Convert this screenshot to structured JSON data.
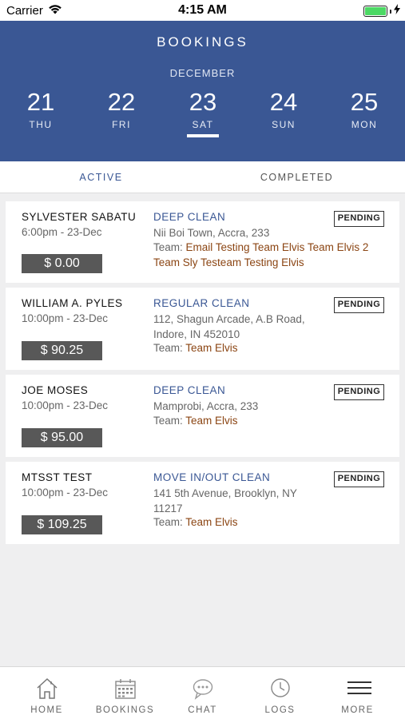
{
  "status_bar": {
    "carrier": "Carrier",
    "time": "4:15 AM",
    "battery_level": 1.0,
    "wifi_icon": "wifi-icon",
    "charging_icon": "charging-bolt-icon"
  },
  "header": {
    "title": "BOOKINGS",
    "month": "DECEMBER",
    "selected_index": 2,
    "background_color": "#3a5794",
    "dates": [
      {
        "day": "21",
        "weekday": "THU"
      },
      {
        "day": "22",
        "weekday": "FRI"
      },
      {
        "day": "23",
        "weekday": "SAT"
      },
      {
        "day": "24",
        "weekday": "SUN"
      },
      {
        "day": "25",
        "weekday": "MON"
      }
    ]
  },
  "tabs": {
    "active": "ACTIVE",
    "completed": "COMPLETED",
    "selected": "active"
  },
  "bookings": [
    {
      "customer": "SYLVESTER SABATU",
      "when": "6:00pm - 23-Dec",
      "price": "$ 0.00",
      "service": "DEEP CLEAN",
      "address": "Nii Boi Town, Accra, 233",
      "team_label": "Team:",
      "teams": [
        "Email Testing",
        "Team Elvis",
        "Team Elvis 2",
        "Team Sly",
        "Testeam",
        "Testing Elvis"
      ],
      "status": "PENDING"
    },
    {
      "customer": "WILLIAM A. PYLES",
      "when": "10:00pm - 23-Dec",
      "price": "$ 90.25",
      "service": "REGULAR CLEAN",
      "address": "112, Shagun Arcade, A.B Road, Indore, IN 452010",
      "team_label": "Team:",
      "teams": [
        "Team Elvis"
      ],
      "status": "PENDING"
    },
    {
      "customer": "JOE MOSES",
      "when": "10:00pm - 23-Dec",
      "price": "$ 95.00",
      "service": "DEEP CLEAN",
      "address": "Mamprobi, Accra, 233",
      "team_label": "Team:",
      "teams": [
        "Team Elvis"
      ],
      "status": "PENDING"
    },
    {
      "customer": "MTSST TEST",
      "when": "10:00pm - 23-Dec",
      "price": "$ 109.25",
      "service": "MOVE IN/OUT CLEAN",
      "address": "141 5th Avenue, Brooklyn, NY 11217",
      "team_label": "Team:",
      "teams": [
        "Team Elvis"
      ],
      "status": "PENDING"
    }
  ],
  "tab_bar": {
    "items": [
      {
        "label": "HOME",
        "icon": "home-icon"
      },
      {
        "label": "BOOKINGS",
        "icon": "calendar-icon"
      },
      {
        "label": "CHAT",
        "icon": "chat-bubble-icon"
      },
      {
        "label": "LOGS",
        "icon": "clock-icon"
      },
      {
        "label": "MORE",
        "icon": "menu-icon"
      }
    ]
  },
  "colors": {
    "brand": "#3a5794",
    "team_text": "#8b4513",
    "price_bg": "#585858",
    "battery": "#4cd964"
  }
}
